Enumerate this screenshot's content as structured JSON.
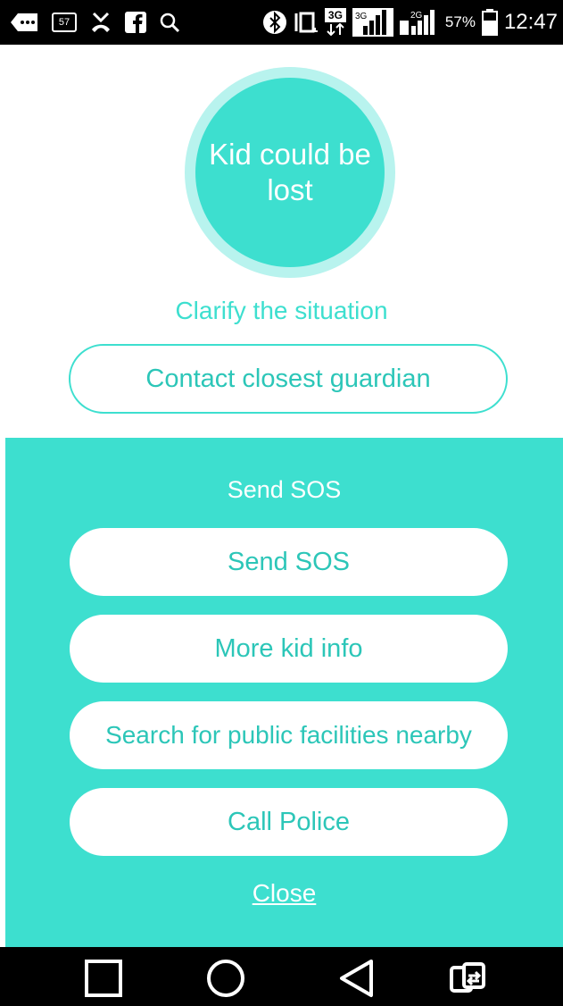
{
  "status_bar": {
    "icons": [
      "back-arrow-icon",
      "messenger-icon",
      "missed-call-icon",
      "facebook-icon",
      "search-icon",
      "bluetooth-icon",
      "vibrate-icon",
      "data-3g-icon",
      "signal-sim1-icon",
      "signal-sim2-icon",
      "battery-icon"
    ],
    "calendar_day": "57",
    "net_type": "3G",
    "battery": "57%",
    "time": "12:47"
  },
  "hero": {
    "status_text": "Kid could be lost"
  },
  "clarify": {
    "label": "Clarify the situation",
    "contact_button": "Contact closest guardian"
  },
  "sos": {
    "title": "Send SOS",
    "buttons": [
      "Send SOS",
      "More kid info",
      "Search for public facilities nearby",
      "Call Police"
    ],
    "close": "Close"
  },
  "nav_bar": {
    "icons": [
      "recent-apps-icon",
      "home-icon",
      "back-icon",
      "screen-mirror-icon"
    ]
  },
  "colors": {
    "accent": "#3ddfcf",
    "accent_light": "#b8f3ee",
    "button_text": "#2cc6b8",
    "bar_background": "#000000"
  }
}
